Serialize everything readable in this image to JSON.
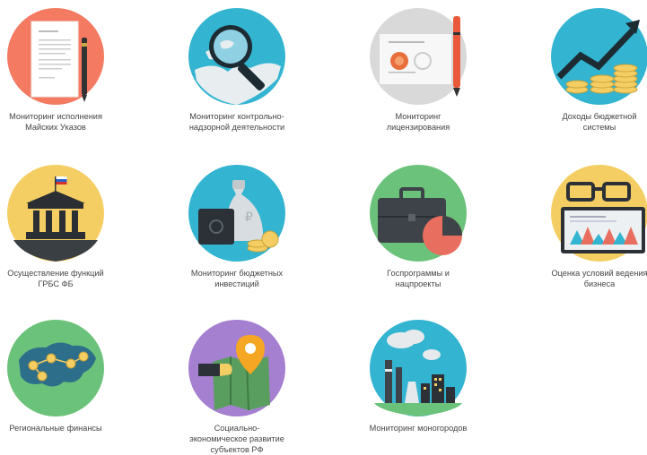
{
  "tiles": [
    {
      "icon": "document-pen-icon",
      "color": "#F47B62",
      "label": [
        "Мониторинг исполнения",
        "Майских Указов"
      ]
    },
    {
      "icon": "globe-magnifier-icon",
      "color": "#33B4D1",
      "label": [
        "Мониторинг контрольно-",
        "надзорной деятельности"
      ]
    },
    {
      "icon": "certificate-seal-icon",
      "color": "#D9D9D9",
      "label": [
        "Мониторинг",
        "лицензирования"
      ]
    },
    {
      "icon": "coins-growth-icon",
      "color": "#33B4D1",
      "label": [
        "Доходы бюджетной",
        "системы"
      ]
    },
    {
      "icon": "government-building-icon",
      "color": "#F5CE63",
      "label": [
        "Осуществление функций",
        "ГРБС ФБ"
      ]
    },
    {
      "icon": "money-bag-safe-icon",
      "color": "#33B4D1",
      "label": [
        "Мониторинг бюджетных",
        "инвестиций"
      ]
    },
    {
      "icon": "briefcase-chart-icon",
      "color": "#6BC27A",
      "label": [
        "Госпрограммы и",
        "нацпроекты"
      ]
    },
    {
      "icon": "glasses-laptop-icon",
      "color": "#F5CE63",
      "label": [
        "Оценка условий ведения",
        "бизнеса"
      ]
    },
    {
      "icon": "russia-map-coins-icon",
      "color": "#6BC27A",
      "label": [
        "Региональные финансы",
        ""
      ]
    },
    {
      "icon": "map-pin-handshake-icon",
      "color": "#A57FD0",
      "label": [
        "Социально-",
        "экономическое развитие",
        "субъектов РФ"
      ]
    },
    {
      "icon": "industrial-town-icon",
      "color": "#33B4D1",
      "label": [
        "Мониторинг моногородов",
        ""
      ]
    }
  ]
}
